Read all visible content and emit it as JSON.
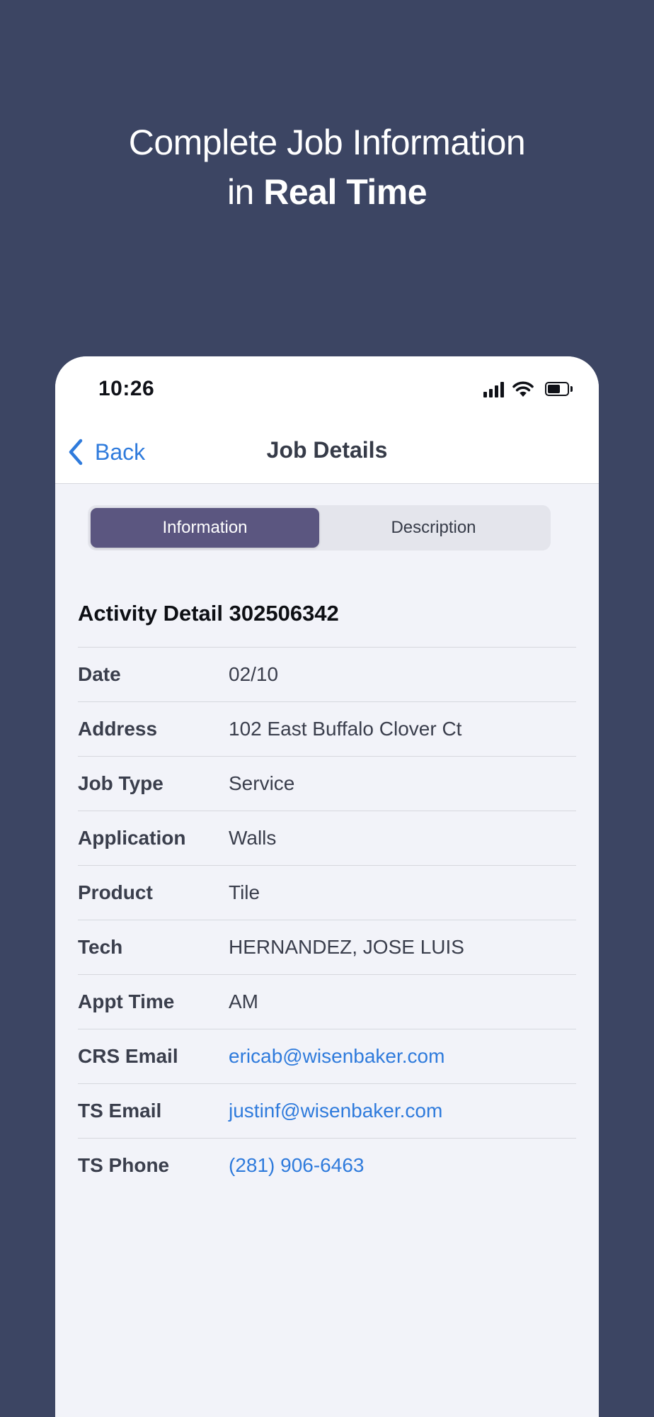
{
  "headline": {
    "line1": "Complete Job Information",
    "line2_prefix": "in ",
    "line2_bold": "Real Time"
  },
  "status_bar": {
    "time": "10:26",
    "icons": [
      "cellular-signal-icon",
      "wifi-icon",
      "battery-icon"
    ]
  },
  "nav": {
    "back_label": "Back",
    "title": "Job Details"
  },
  "segments": {
    "information": "Information",
    "description": "Description",
    "selected": "Information"
  },
  "activity": {
    "title": "Activity Detail 302506342",
    "fields": [
      {
        "label": "Date",
        "value": "02/10"
      },
      {
        "label": "Address",
        "value": "102 East Buffalo Clover Ct"
      },
      {
        "label": "Job Type",
        "value": "Service"
      },
      {
        "label": "Application",
        "value": "Walls"
      },
      {
        "label": "Product",
        "value": "Tile"
      },
      {
        "label": "Tech",
        "value": "HERNANDEZ, JOSE LUIS"
      },
      {
        "label": "Appt Time",
        "value": "AM"
      },
      {
        "label": "CRS Email",
        "value": "ericab@wisenbaker.com"
      },
      {
        "label": "TS Email",
        "value": "justinf@wisenbaker.com"
      },
      {
        "label": "TS Phone",
        "value": "(281) 906-6463"
      }
    ]
  },
  "colors": {
    "background": "#3c4563",
    "accent_link": "#2f7bdc",
    "segment_active": "#5b5680"
  }
}
